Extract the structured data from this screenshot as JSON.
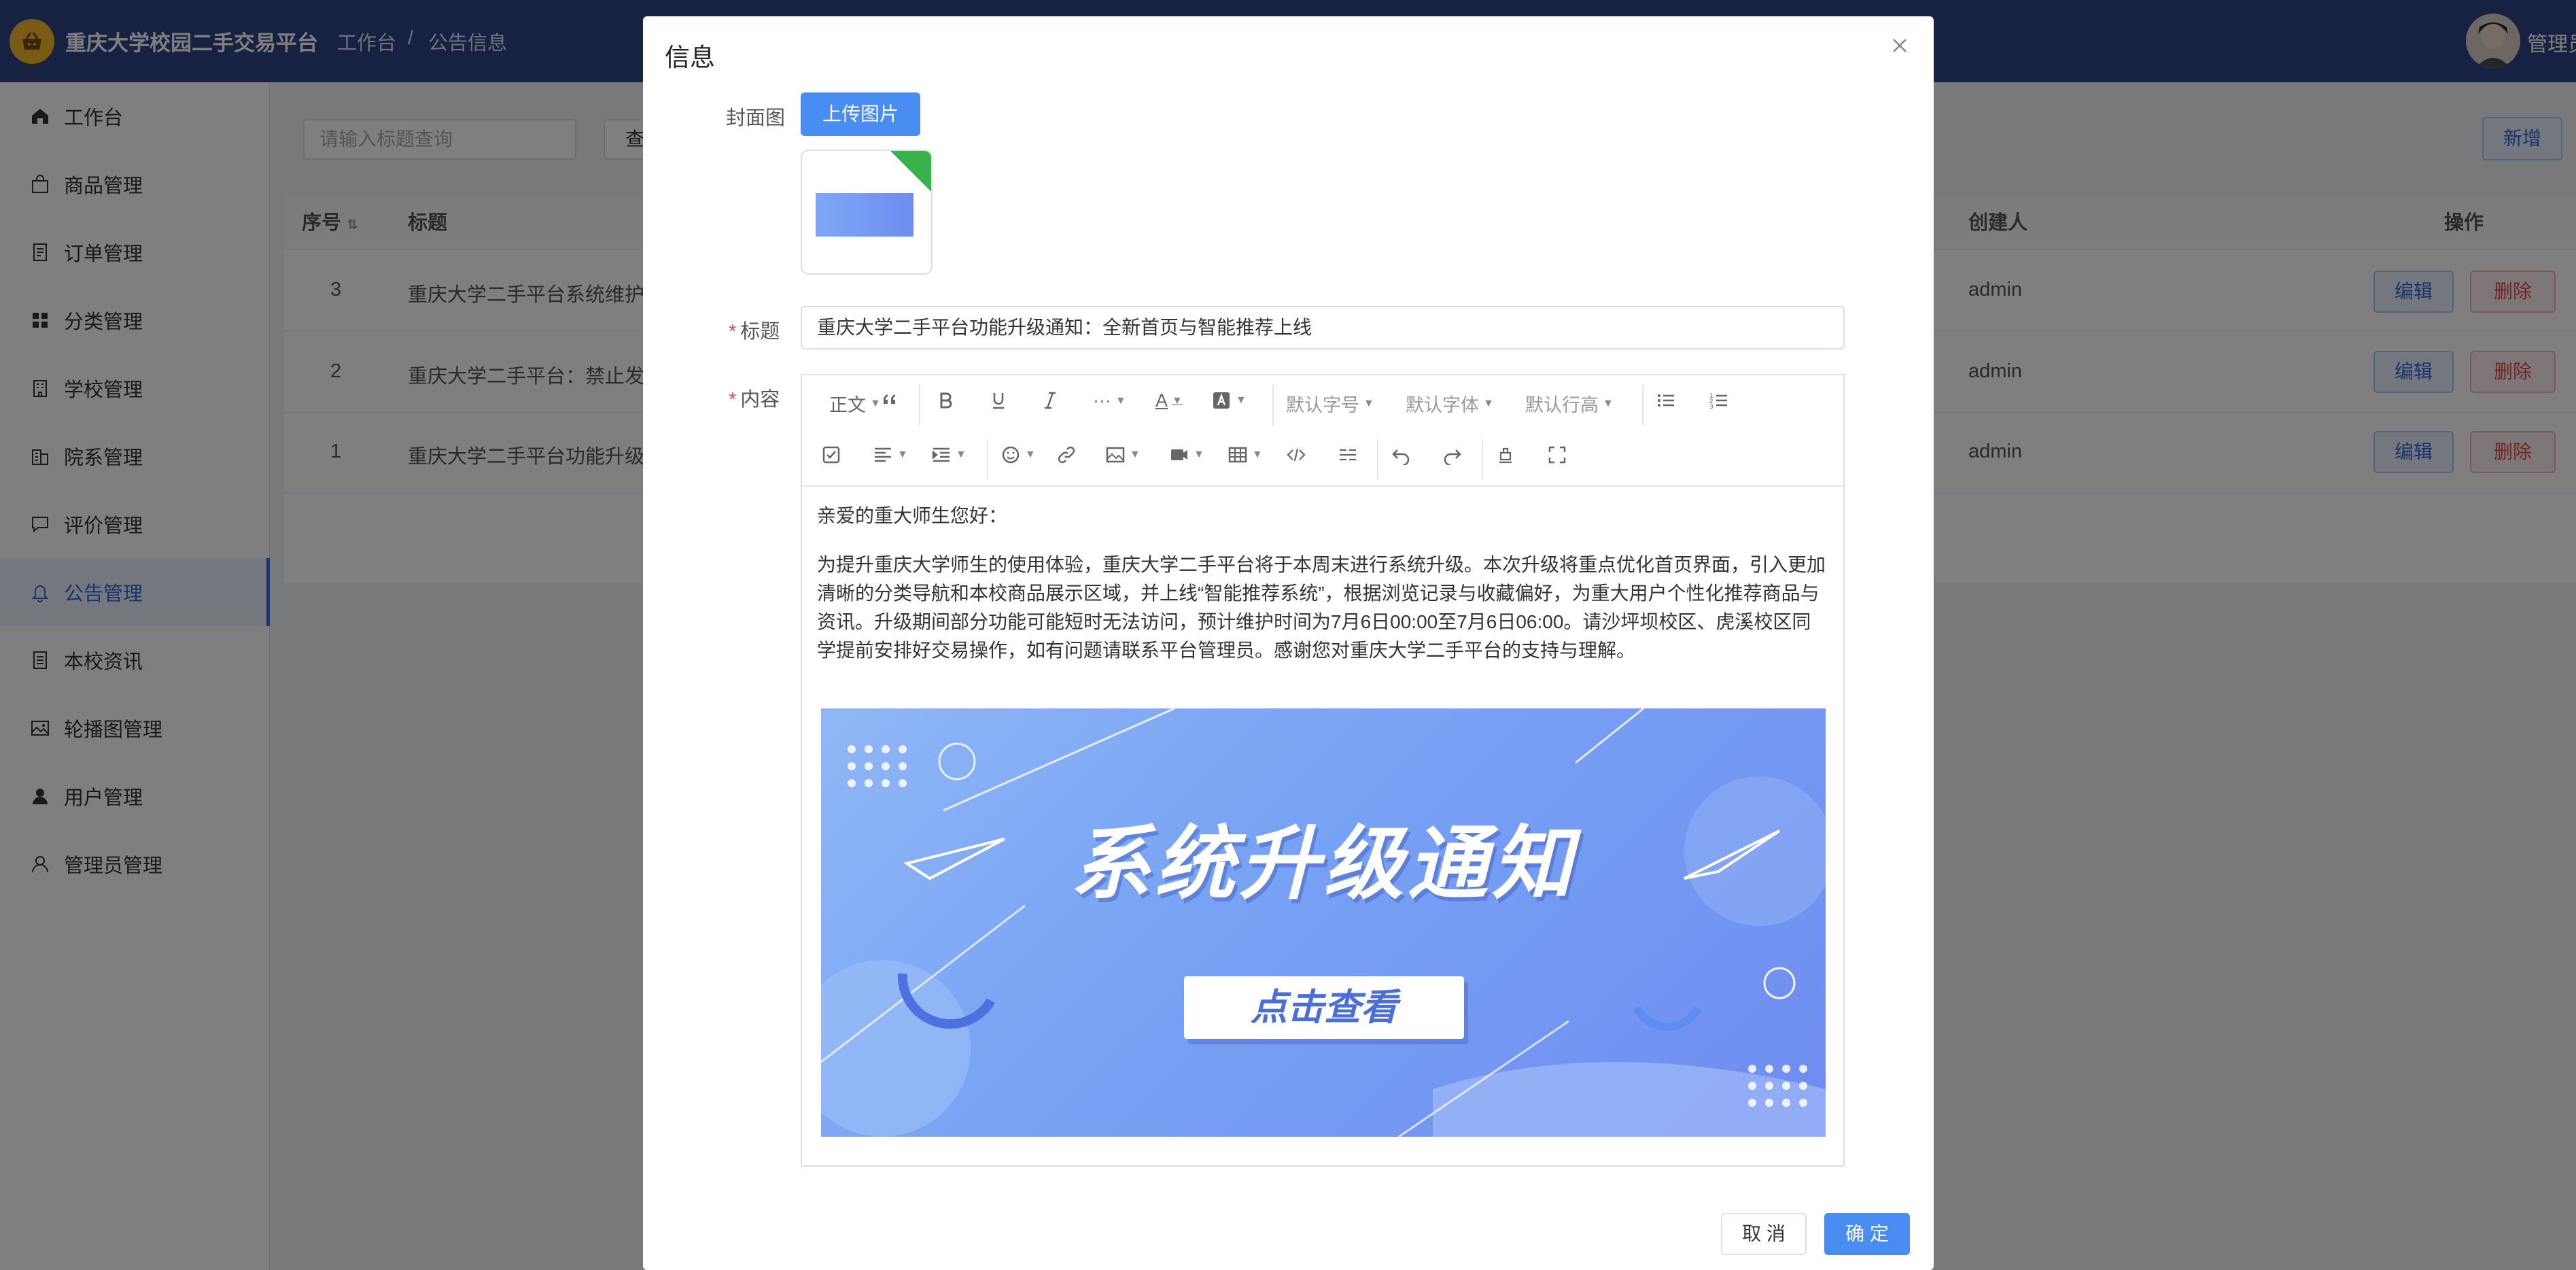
{
  "header": {
    "app_title": "重庆大学校园二手交易平台",
    "breadcrumb": [
      "工作台",
      "/",
      "公告信息"
    ],
    "admin_name": "管理员"
  },
  "sidebar": {
    "items": [
      {
        "label": "工作台",
        "icon": "home-icon"
      },
      {
        "label": "商品管理",
        "icon": "bag-icon"
      },
      {
        "label": "订单管理",
        "icon": "document-icon"
      },
      {
        "label": "分类管理",
        "icon": "grid-icon"
      },
      {
        "label": "学校管理",
        "icon": "building-icon"
      },
      {
        "label": "院系管理",
        "icon": "office-icon"
      },
      {
        "label": "评价管理",
        "icon": "comment-icon"
      },
      {
        "label": "公告管理",
        "icon": "bell-icon",
        "active": true
      },
      {
        "label": "本校资讯",
        "icon": "news-icon"
      },
      {
        "label": "轮播图管理",
        "icon": "picture-icon"
      },
      {
        "label": "用户管理",
        "icon": "user-filled-icon"
      },
      {
        "label": "管理员管理",
        "icon": "user-outline-icon"
      }
    ]
  },
  "toolbar": {
    "search_placeholder": "请输入标题查询",
    "query_label": "查",
    "add_label": "新增"
  },
  "table": {
    "headers": {
      "index": "序号",
      "title": "标题",
      "creator": "创建人",
      "actions": "操作"
    },
    "rows": [
      {
        "index": "3",
        "title": "重庆大学二手平台系统维护公",
        "creator": "admin"
      },
      {
        "index": "2",
        "title": "重庆大学二手平台：禁止发布",
        "creator": "admin"
      },
      {
        "index": "1",
        "title": "重庆大学二手平台功能升级通",
        "creator": "admin"
      }
    ],
    "edit_label": "编辑",
    "delete_label": "删除"
  },
  "dialog": {
    "title": "信息",
    "cover_label": "封面图",
    "upload_label": "上传图片",
    "title_label": "标题",
    "title_value": "重庆大学二手平台功能升级通知：全新首页与智能推荐上线",
    "content_label": "内容",
    "cancel_label": "取 消",
    "ok_label": "确 定"
  },
  "editor": {
    "toolbar": {
      "paragraph": "正文",
      "more": "···",
      "font_color": "A",
      "font_size": "默认字号",
      "font_family": "默认字体",
      "line_height": "默认行高"
    },
    "greeting": "亲爱的重大师生您好：",
    "body": "为提升重庆大学师生的使用体验，重庆大学二手平台将于本周末进行系统升级。本次升级将重点优化首页界面，引入更加清晰的分类导航和本校商品展示区域，并上线“智能推荐系统”，根据浏览记录与收藏偏好，为重大用户个性化推荐商品与资讯。升级期间部分功能可能短时无法访问，预计维护时间为7月6日00:00至7月6日06:00。请沙坪坝校区、虎溪校区同学提前安排好交易操作，如有问题请联系平台管理员。感谢您对重庆大学二手平台的支持与理解。",
    "banner_title": "系统升级通知",
    "banner_button": "点击查看"
  },
  "colors": {
    "header_bg": "#2e4584",
    "primary": "#4a8df2",
    "danger": "#e34d4d",
    "active_menu": "#2f6bd6"
  }
}
